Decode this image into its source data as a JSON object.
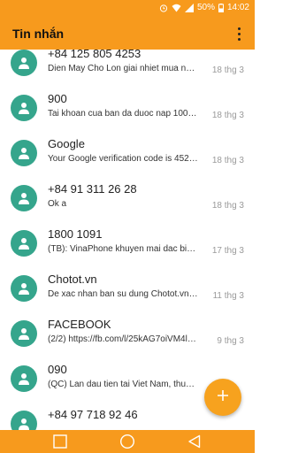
{
  "status_bar": {
    "battery": "50%",
    "time": "14:02",
    "icons": [
      "alarm-icon",
      "wifi-icon",
      "signal-icon",
      "battery-icon"
    ]
  },
  "app_bar": {
    "title": "Tin nhắn",
    "menu_icon": "more-vert-icon"
  },
  "conversations": [
    {
      "name": "+84 125 805 4253",
      "preview": "Dien May Cho Lon giai nhiet mua nong...",
      "date": "18 thg 3"
    },
    {
      "name": "900",
      "preview": "Tai khoan cua ban da duoc nap 100,000d",
      "date": "18 thg 3"
    },
    {
      "name": "Google",
      "preview": "Your Google verification code is 452118",
      "date": "18 thg 3"
    },
    {
      "name": "+84 91 311 26 28",
      "preview": "Ok a",
      "date": "18 thg 3"
    },
    {
      "name": "1800 1091",
      "preview": "(TB): VinaPhone khuyen mai dac biet cho ban",
      "date": "17 thg 3"
    },
    {
      "name": "Chotot.vn",
      "preview": "De xac nhan ban su dung Chotot.vn, vui long",
      "date": "11 thg 3"
    },
    {
      "name": "FACEBOOK",
      "preview": "(2/2) https://fb.com/l/25kAG7oiVM4lKzx",
      "date": "9 thg 3"
    },
    {
      "name": "090",
      "preview": "(QC) Lan dau tien tai Viet Nam, thue bao",
      "date": ""
    },
    {
      "name": "+84 97 718 92 46",
      "preview": "",
      "date": ""
    }
  ],
  "fab": {
    "icon": "plus-icon"
  },
  "nav_bar": {
    "icons": [
      "recent-apps-icon",
      "home-icon",
      "back-icon"
    ]
  },
  "colors": {
    "accent": "#f79a1d",
    "avatar": "#35a58c",
    "fab": "#f7a21e"
  }
}
